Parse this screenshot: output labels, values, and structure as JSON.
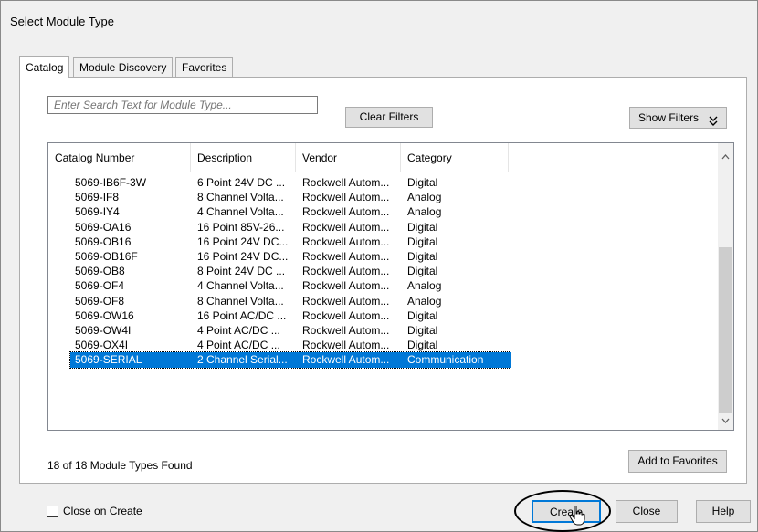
{
  "dialog": {
    "title": "Select Module Type"
  },
  "tabs": [
    {
      "label": "Catalog",
      "active": true
    },
    {
      "label": "Module Discovery",
      "active": false
    },
    {
      "label": "Favorites",
      "active": false
    }
  ],
  "search": {
    "placeholder": "Enter Search Text for Module Type..."
  },
  "buttons": {
    "clear_filters": "Clear Filters",
    "show_filters": "Show Filters",
    "show_filters_icon": "double-chevron-down-icon",
    "add_to_favorites": "Add to Favorites",
    "create": "Create",
    "close": "Close",
    "help": "Help"
  },
  "table": {
    "columns": [
      "Catalog Number",
      "Description",
      "Vendor",
      "Category"
    ],
    "rows": [
      [
        "5069-IB6F-3W",
        "6 Point 24V DC ...",
        "Rockwell Autom...",
        "Digital"
      ],
      [
        "5069-IF8",
        "8 Channel Volta...",
        "Rockwell Autom...",
        "Analog"
      ],
      [
        "5069-IY4",
        "4 Channel Volta...",
        "Rockwell Autom...",
        "Analog"
      ],
      [
        "5069-OA16",
        "16 Point 85V-26...",
        "Rockwell Autom...",
        "Digital"
      ],
      [
        "5069-OB16",
        "16 Point 24V DC...",
        "Rockwell Autom...",
        "Digital"
      ],
      [
        "5069-OB16F",
        "16 Point 24V DC...",
        "Rockwell Autom...",
        "Digital"
      ],
      [
        "5069-OB8",
        "8 Point 24V DC ...",
        "Rockwell Autom...",
        "Digital"
      ],
      [
        "5069-OF4",
        "4 Channel Volta...",
        "Rockwell Autom...",
        "Analog"
      ],
      [
        "5069-OF8",
        "8 Channel Volta...",
        "Rockwell Autom...",
        "Analog"
      ],
      [
        "5069-OW16",
        "16 Point AC/DC ...",
        "Rockwell Autom...",
        "Digital"
      ],
      [
        "5069-OW4I",
        "4 Point AC/DC ...",
        "Rockwell Autom...",
        "Digital"
      ],
      [
        "5069-OX4I",
        "4 Point AC/DC ...",
        "Rockwell Autom...",
        "Digital"
      ],
      [
        "5069-SERIAL",
        "2 Channel Serial...",
        "Rockwell Autom...",
        "Communication"
      ]
    ],
    "selected_row": 12
  },
  "status": {
    "found_text": "18 of 18 Module Types Found"
  },
  "options": {
    "close_on_create_label": "Close on Create",
    "close_on_create_checked": false
  },
  "colors": {
    "selection": "#0078d7",
    "dialog_bg": "#f0f0f0"
  }
}
